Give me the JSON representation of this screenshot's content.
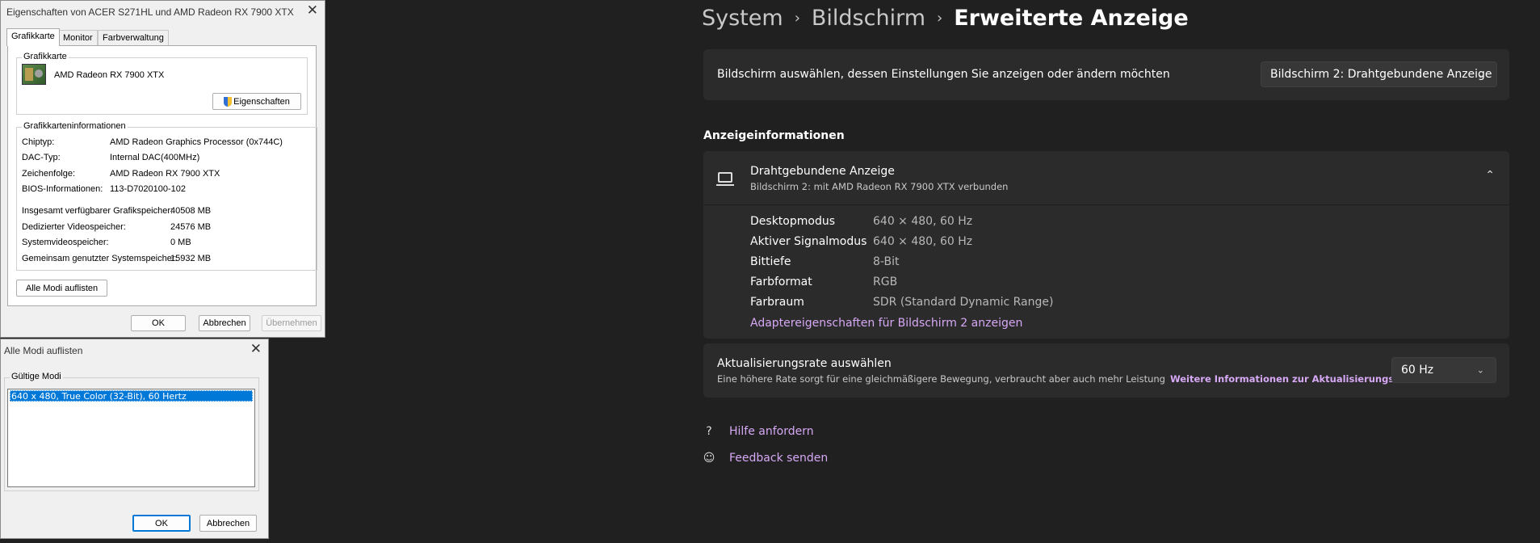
{
  "settings": {
    "breadcrumb": [
      "System",
      "Bildschirm",
      "Erweiterte Anzeige"
    ],
    "select_label": "Bildschirm auswählen, dessen Einstellungen Sie anzeigen oder ändern möchten",
    "screen_dropdown": "Bildschirm 2: Drahtgebundene Anzeige",
    "section_title": "Anzeigeinformationen",
    "display_name": "Drahtgebundene Anzeige",
    "display_sub": "Bildschirm 2: mit AMD Radeon RX 7900 XTX verbunden",
    "props": [
      {
        "label": "Desktopmodus",
        "value": "640 × 480, 60 Hz"
      },
      {
        "label": "Aktiver Signalmodus",
        "value": "640 × 480, 60 Hz"
      },
      {
        "label": "Bittiefe",
        "value": "8-Bit"
      },
      {
        "label": "Farbformat",
        "value": "RGB"
      },
      {
        "label": "Farbraum",
        "value": "SDR (Standard Dynamic Range)"
      }
    ],
    "adapter_link": "Adaptereigenschaften für Bildschirm 2 anzeigen",
    "rate_title": "Aktualisierungsrate auswählen",
    "rate_sub": "Eine höhere Rate sorgt für eine gleichmäßigere Bewegung, verbraucht aber auch mehr Leistung",
    "rate_link": "Weitere Informationen zur Aktualisierungsrate",
    "rate_value": "60 Hz",
    "help": "Hilfe anfordern",
    "feedback": "Feedback senden",
    "accent": "#d6a8f5"
  },
  "props_dialog": {
    "title": "Eigenschaften von ACER S271HL und AMD Radeon RX 7900 XTX",
    "tabs": [
      "Grafikkarte",
      "Monitor",
      "Farbverwaltung"
    ],
    "adapter_group": "Grafikkarte",
    "adapter_name": "AMD Radeon RX 7900 XTX",
    "properties_button": "Eigenschaften",
    "info_group": "Grafikkarteninformationen",
    "info": [
      {
        "label": "Chiptyp:",
        "value": "AMD Radeon Graphics Processor (0x744C)"
      },
      {
        "label": "DAC-Typ:",
        "value": "Internal DAC(400MHz)"
      },
      {
        "label": "Zeichenfolge:",
        "value": "AMD Radeon RX 7900 XTX"
      },
      {
        "label": "BIOS-Informationen:",
        "value": "113-D7020100-102"
      }
    ],
    "memory": [
      {
        "label": "Insgesamt verfügbarer Grafikspeicher:",
        "value": "40508 MB"
      },
      {
        "label": "Dedizierter Videospeicher:",
        "value": "24576 MB"
      },
      {
        "label": "Systemvideospeicher:",
        "value": "0 MB"
      },
      {
        "label": "Gemeinsam genutzter Systemspeicher:",
        "value": "15932 MB"
      }
    ],
    "list_modes_button": "Alle Modi auflisten",
    "ok": "OK",
    "cancel": "Abbrechen",
    "apply": "Übernehmen"
  },
  "modes_dialog": {
    "title": "Alle Modi auflisten",
    "group": "Gültige Modi",
    "selected_mode": "640 x 480, True Color (32-Bit), 60 Hertz",
    "ok": "OK",
    "cancel": "Abbrechen"
  }
}
